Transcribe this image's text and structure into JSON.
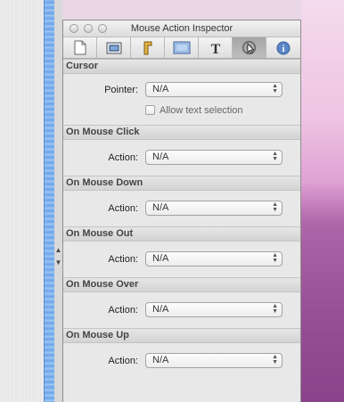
{
  "window": {
    "title": "Mouse Action Inspector"
  },
  "tabs": [
    {
      "name": "document-icon"
    },
    {
      "name": "metrics-icon"
    },
    {
      "name": "graphic-icon"
    },
    {
      "name": "layout-icon"
    },
    {
      "name": "text-icon"
    },
    {
      "name": "mouse-action-icon",
      "selected": true
    },
    {
      "name": "info-icon"
    }
  ],
  "cursor": {
    "header": "Cursor",
    "pointer_label": "Pointer:",
    "pointer_value": "N/A",
    "allow_selection_label": "Allow text selection",
    "allow_selection_checked": false
  },
  "sections": [
    {
      "header": "On Mouse Click",
      "action_label": "Action:",
      "action_value": "N/A"
    },
    {
      "header": "On Mouse Down",
      "action_label": "Action:",
      "action_value": "N/A"
    },
    {
      "header": "On Mouse Out",
      "action_label": "Action:",
      "action_value": "N/A"
    },
    {
      "header": "On Mouse Over",
      "action_label": "Action:",
      "action_value": "N/A"
    },
    {
      "header": "On Mouse Up",
      "action_label": "Action:",
      "action_value": "N/A"
    }
  ],
  "colors": {
    "rail": "#6aa4e8",
    "selected_tab": "#a6a6a6",
    "desktop": "#d58ccb"
  }
}
